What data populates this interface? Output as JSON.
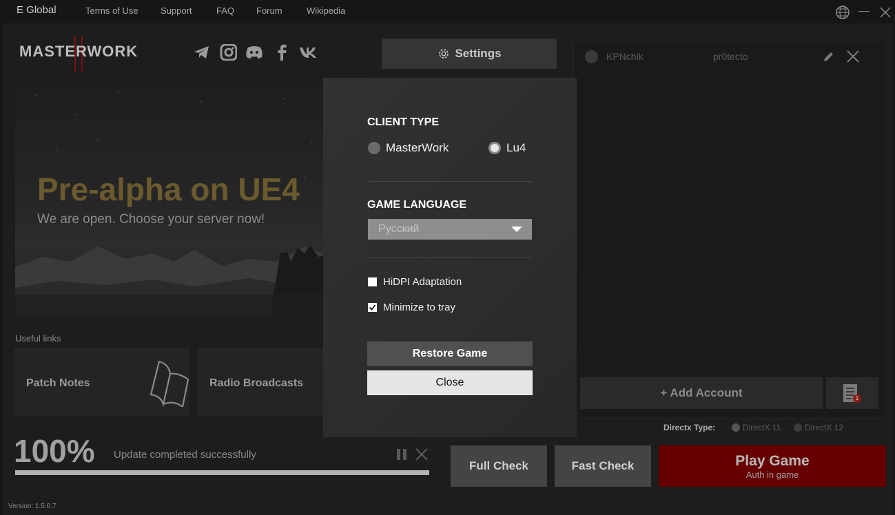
{
  "topbar": {
    "brand": "E Global",
    "links": [
      "Terms of Use",
      "Support",
      "FAQ",
      "Forum",
      "Wikipedia"
    ]
  },
  "header": {
    "logo": "MASTERWORK",
    "social_icons": [
      "telegram-icon",
      "instagram-icon",
      "discord-icon",
      "facebook-icon",
      "vk-icon"
    ],
    "settings_label": "Settings"
  },
  "banner": {
    "title": "Pre-alpha on UE4",
    "subtitle": "We are open. Choose your server now!"
  },
  "useful_links": {
    "label": "Useful links",
    "cards": [
      "Patch Notes",
      "Radio Broadcasts"
    ]
  },
  "accounts": {
    "items": [
      {
        "name": "KPNchik",
        "server": "pr0tecto"
      }
    ],
    "add_label": "+  Add Account",
    "log_badge": "1"
  },
  "directx": {
    "label": "Directx Type:",
    "options": [
      "DirectX 11",
      "DirectX 12"
    ],
    "selected": "DirectX 11"
  },
  "progress": {
    "percent_label": "100%",
    "value": 1.0,
    "status": "Update completed successfully"
  },
  "actions": {
    "full_check": "Full Check",
    "fast_check": "Fast Check",
    "play_label": "Play Game",
    "play_sub": "Auth in game"
  },
  "version": "Version: 1.5.0.7",
  "settings_modal": {
    "client_type_label": "CLIENT TYPE",
    "client_options": [
      "MasterWork",
      "Lu4"
    ],
    "client_selected": "Lu4",
    "language_label": "GAME LANGUAGE",
    "language_value": "Русский",
    "hidpi_label": "HiDPI Adaptation",
    "hidpi_checked": false,
    "tray_label": "Minimize to tray",
    "tray_checked": true,
    "restore_label": "Restore Game",
    "close_label": "Close"
  },
  "colors": {
    "accent_gold": "#6b5a2e",
    "play_red": "#660000"
  }
}
